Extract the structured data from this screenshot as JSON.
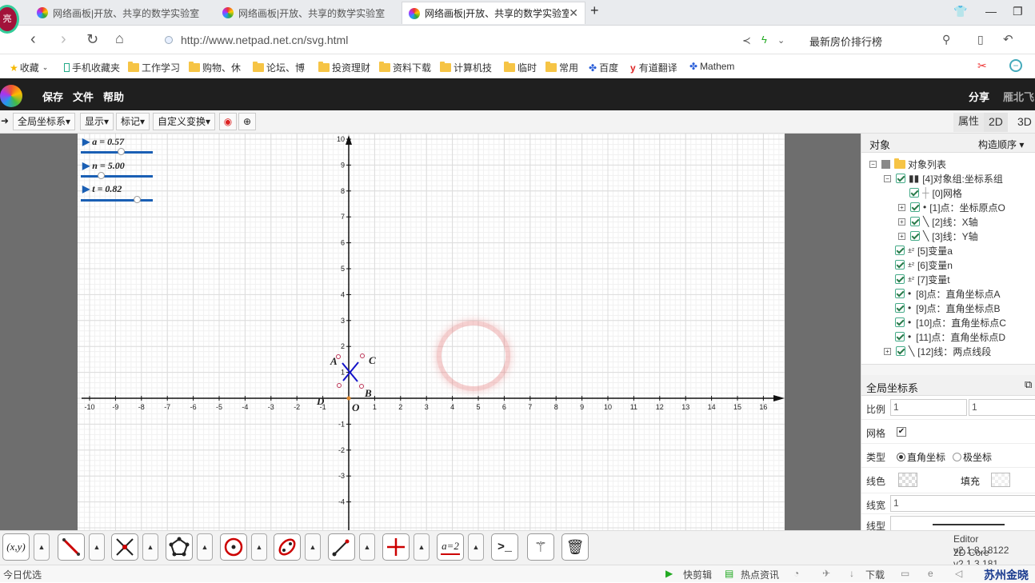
{
  "browser": {
    "tabs": [
      {
        "title": "网络画板|开放、共享的数学实验室"
      },
      {
        "title": "网络画板|开放、共享的数学实验室"
      },
      {
        "title": "网络画板|开放、共享的数学实验室"
      }
    ],
    "badge": "亮",
    "url": "http://www.netpad.net.cn/svg.html",
    "hot_search": "最新房价排行榜",
    "bookmarks": [
      "收藏",
      "手机收藏夹",
      "工作学习",
      "购物、休",
      "论坛、博",
      "投资理财",
      "资料下载",
      "计算机技",
      "临时",
      "常用",
      "百度",
      "有道翻译",
      "Mathem"
    ]
  },
  "app": {
    "menu": [
      "保存",
      "文件",
      "帮助"
    ],
    "share": "分享",
    "user": "雁北飞",
    "toolbar": [
      "全局坐标系▾",
      "显示▾",
      "标记▾",
      "自定义变换▾"
    ],
    "right_tabs": [
      "属性",
      "2D",
      "3D"
    ]
  },
  "sliders": [
    {
      "label": "a = 0.57",
      "value": 0.57
    },
    {
      "label": "n = 5.00",
      "value": 5.0
    },
    {
      "label": "t = 0.82",
      "value": 0.82
    }
  ],
  "graph": {
    "x_ticks": [
      "-10",
      "-9",
      "-8",
      "-7",
      "-6",
      "-5",
      "-4",
      "-3",
      "-2",
      "-1",
      "1",
      "2",
      "3",
      "4",
      "5",
      "6",
      "7",
      "8",
      "9",
      "10",
      "11",
      "12",
      "13",
      "14",
      "15",
      "16"
    ],
    "y_ticks": [
      "10",
      "9",
      "8",
      "7",
      "6",
      "5",
      "4",
      "3",
      "2",
      "1",
      "-1",
      "-2",
      "-3",
      "-4"
    ],
    "origin_label": "O",
    "points": [
      "A",
      "B",
      "C",
      "D"
    ]
  },
  "panel": {
    "tab_objects": "对象",
    "order": "构造顺序 ▾",
    "tree": [
      "对象列表",
      "[4]对象组:坐标系组",
      "[0]网格",
      "[1]点：坐标原点O",
      "[2]线：X轴",
      "[3]线：Y轴",
      "[5]变量a",
      "[6]变量n",
      "[7]变量t",
      "[8]点：直角坐标点A",
      "[9]点：直角坐标点B",
      "[10]点：直角坐标点C",
      "[11]点：直角坐标点D",
      "[12]线：两点线段"
    ],
    "section_title": "全局坐标系",
    "scale_label": "比例",
    "scale_x": "1",
    "scale_y": "1",
    "grid_label": "网格",
    "type_label": "类型",
    "type_rect": "直角坐标",
    "type_polar": "极坐标",
    "line_color_label": "线色",
    "fill_label": "填充",
    "line_width_label": "线宽",
    "line_width": "1",
    "line_type_label": "线型",
    "version_editor": "Editor v2.1.8.18122",
    "version_core": "2D Core v2.1.3.181"
  },
  "status": {
    "left": "今日优选",
    "items": [
      "快剪辑",
      "热点资讯",
      "下载"
    ],
    "right": "苏州金晓"
  }
}
